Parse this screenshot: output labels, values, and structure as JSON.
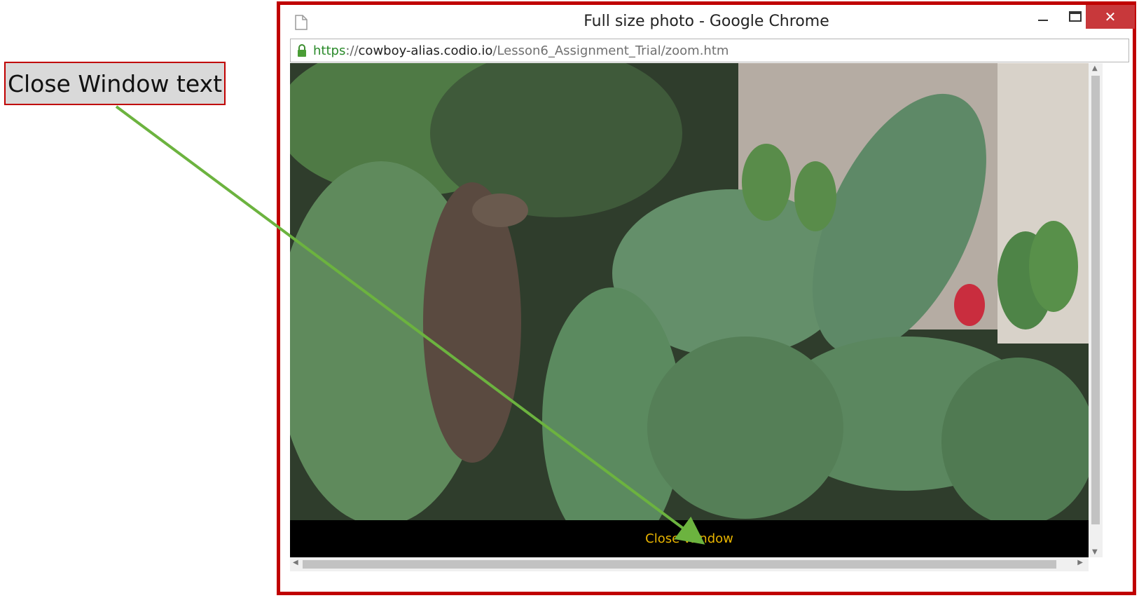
{
  "annotation": {
    "callout_text": "Close Window text"
  },
  "window": {
    "title": "Full size photo - Google Chrome",
    "close_glyph": "✕"
  },
  "addressbar": {
    "scheme": "https",
    "separator": "://",
    "host": "cowboy-alias.codio.io",
    "path": "/Lesson6_Assignment_Trial/zoom.htm"
  },
  "page": {
    "close_link": "Close Window"
  },
  "colors": {
    "frame_border": "#c00000",
    "arrow": "#6cb33f",
    "close_link": "#e8b400",
    "close_button": "#c8383b"
  },
  "icons": {
    "page": "page-icon",
    "lock": "lock-icon",
    "minimize": "minimize-icon",
    "maximize": "maximize-icon",
    "close": "close-icon"
  }
}
